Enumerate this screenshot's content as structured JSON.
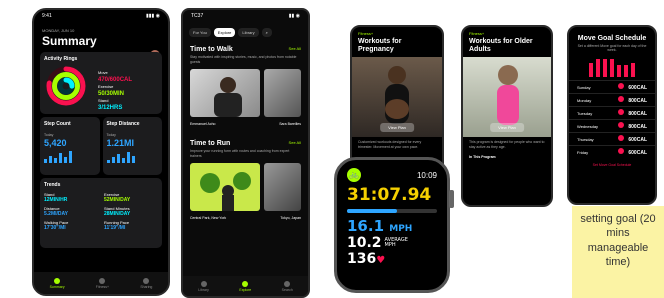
{
  "phone1": {
    "time": "9:41",
    "date": "MONDAY, JUN 10",
    "title": "Summary",
    "activity": {
      "title": "Activity Rings",
      "move_label": "Move",
      "move_value": "470/600CAL",
      "exercise_label": "Exercise",
      "exercise_value": "50/30MIN",
      "stand_label": "Stand",
      "stand_value": "3/12HRS"
    },
    "step_count": {
      "title": "Step Count",
      "sub": "Today",
      "value": "5,420"
    },
    "step_distance": {
      "title": "Step Distance",
      "sub": "Today",
      "value": "1.21MI"
    },
    "trends": {
      "title": "Trends",
      "items": [
        {
          "label": "Stand",
          "value": "12MIN/HR"
        },
        {
          "label": "Exercise",
          "value": "52MIN/DAY"
        },
        {
          "label": "Distance",
          "value": "5.2MI/DAY"
        },
        {
          "label": "Stand Minutes",
          "value": "28MIN/DAY"
        },
        {
          "label": "Walking Pace",
          "value": "17'30\"/MI"
        },
        {
          "label": "Running Pace",
          "value": "11'19\"/MI"
        }
      ]
    },
    "tabs": [
      "Summary",
      "Fitness+",
      "Sharing"
    ]
  },
  "phone2": {
    "time": "TC37",
    "tabs": [
      "For You",
      "Explore",
      "Library"
    ],
    "walk": {
      "title": "Time to Walk",
      "more": "See All",
      "desc": "Stay motivated with inspiring stories, music, and photos from notable guests",
      "cap1": "Emmanuel Acho",
      "cap2": "Sara Bareilles"
    },
    "run": {
      "title": "Time to Run",
      "more": "See All",
      "desc": "Improve your running form with routes and coaching from expert trainers",
      "cap1": "Central Park, New York",
      "cap2": "Tokyo, Japan"
    },
    "tabbar": [
      "Library",
      "Explore",
      "Search"
    ]
  },
  "phone3": {
    "back": "Fitness+",
    "title": "Workouts for Pregnancy",
    "button": "View Plan",
    "desc": "Customized workouts designed for every trimester. Movement at your own pace."
  },
  "phone4": {
    "back": "Fitness+",
    "title": "Workouts for Older Adults",
    "button": "View Plan",
    "desc": "This program is designed for people who want to stay active as they age.",
    "in_program": "In This Program"
  },
  "phone5": {
    "title": "Move Goal Schedule",
    "sub": "Set a different Move goal for each day of the week.",
    "rows": [
      {
        "day": "Sunday",
        "value": "600CAL"
      },
      {
        "day": "Monday",
        "value": "800CAL"
      },
      {
        "day": "Tuesday",
        "value": "800CAL"
      },
      {
        "day": "Wednesday",
        "value": "800CAL"
      },
      {
        "day": "Thursday",
        "value": "600CAL"
      },
      {
        "day": "Friday",
        "value": "600CAL"
      }
    ],
    "chart_values": [
      0.7,
      0.9,
      0.9,
      0.9,
      0.6,
      0.6,
      0.7
    ],
    "footer": "Set Move Goal Schedule"
  },
  "watch": {
    "time": "10:09",
    "elapsed": "31:07.94",
    "speed": "16.1",
    "speed_unit": "MPH",
    "avg": "10.2",
    "avg_label1": "AVERAGE",
    "avg_label2": "MPH",
    "heart_rate": "136",
    "progress": 0.55
  },
  "note": {
    "text": "setting goal (20 mins manageable time)"
  },
  "colors": {
    "move": "#fa114f",
    "exercise": "#a6ff00",
    "stand": "#00f0ff",
    "accent_blue": "#2ea5ff",
    "elapsed_yellow": "#f5d000"
  }
}
